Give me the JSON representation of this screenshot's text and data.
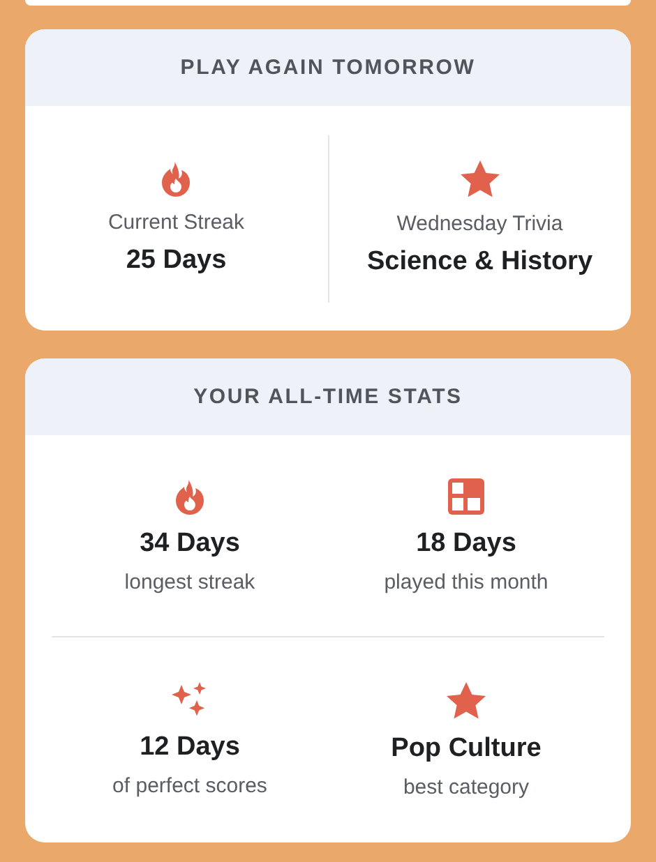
{
  "today_card": {
    "title": "PLAY AGAIN TOMORROW",
    "items": [
      {
        "label": "Current Streak",
        "value": "25 Days"
      },
      {
        "label": "Wednesday Trivia",
        "value": "Science & History"
      }
    ]
  },
  "stats_card": {
    "title": "YOUR ALL-TIME STATS",
    "rows": [
      [
        {
          "value": "34 Days",
          "label": "longest streak"
        },
        {
          "value": "18 Days",
          "label": "played this month"
        }
      ],
      [
        {
          "value": "12 Days",
          "label": "of perfect scores"
        },
        {
          "value": "Pop Culture",
          "label": "best category"
        }
      ]
    ]
  }
}
